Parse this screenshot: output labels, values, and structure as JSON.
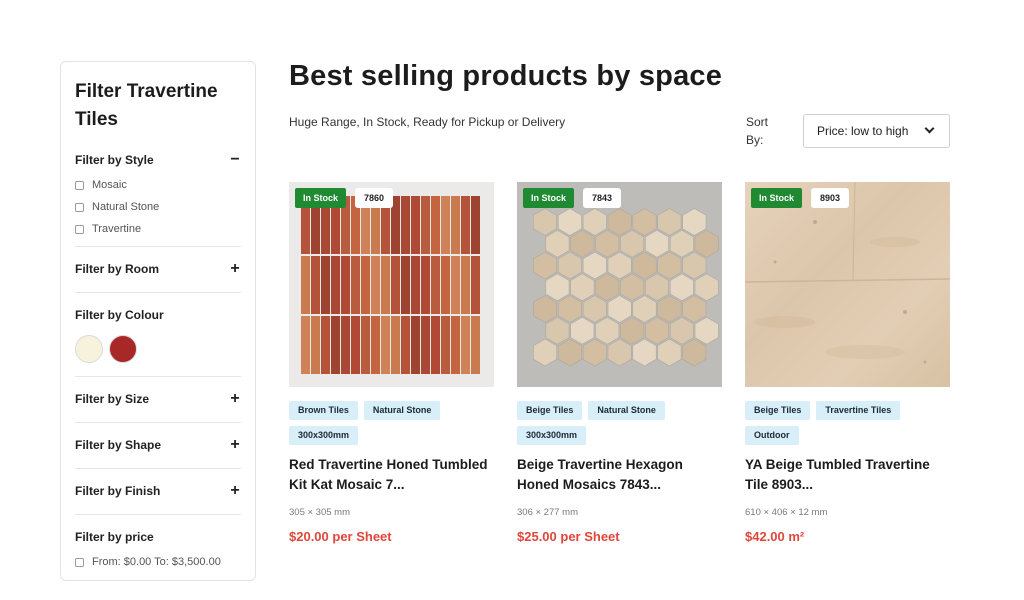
{
  "sidebar": {
    "title": "Filter Travertine Tiles",
    "style": {
      "label": "Filter by Style",
      "toggle": "−",
      "options": [
        "Mosaic",
        "Natural Stone",
        "Travertine"
      ]
    },
    "room": {
      "label": "Filter by Room",
      "toggle": "+"
    },
    "colour": {
      "label": "Filter by Colour",
      "swatches": [
        "#f6f2dc",
        "#a82828"
      ]
    },
    "size": {
      "label": "Filter by Size",
      "toggle": "+"
    },
    "shape": {
      "label": "Filter by Shape",
      "toggle": "+"
    },
    "finish": {
      "label": "Filter by Finish",
      "toggle": "+"
    },
    "price": {
      "label": "Filter by price",
      "range_text": "From: $0.00 To: $3,500.00"
    }
  },
  "main": {
    "title": "Best selling products by space",
    "subtitle": "Huge Range, In Stock, Ready for Pickup or Delivery",
    "sort_label": "Sort By:",
    "sort_value": "Price: low to high"
  },
  "products": [
    {
      "stock": "In Stock",
      "sku": "7860",
      "tags": [
        "Brown Tiles",
        "Natural Stone",
        "300x300mm"
      ],
      "name": "Red Travertine Honed Tumbled Kit Kat Mosaic 7...",
      "dims": "305 × 305 mm",
      "price": "$20.00 per Sheet"
    },
    {
      "stock": "In Stock",
      "sku": "7843",
      "tags": [
        "Beige Tiles",
        "Natural Stone",
        "300x300mm"
      ],
      "name": "Beige Travertine Hexagon Honed Mosaics 7843...",
      "dims": "306 × 277 mm",
      "price": "$25.00 per Sheet"
    },
    {
      "stock": "In Stock",
      "sku": "8903",
      "tags": [
        "Beige Tiles",
        "Travertine Tiles",
        "Outdoor"
      ],
      "name": "YA Beige Tumbled Travertine Tile 8903...",
      "dims": "610 × 406 × 12 mm",
      "price": "$42.00 m²"
    }
  ],
  "colors": {
    "accent_price": "#e0473a",
    "stock_badge": "#1f8a32",
    "tag_bg": "#d8eef8"
  }
}
